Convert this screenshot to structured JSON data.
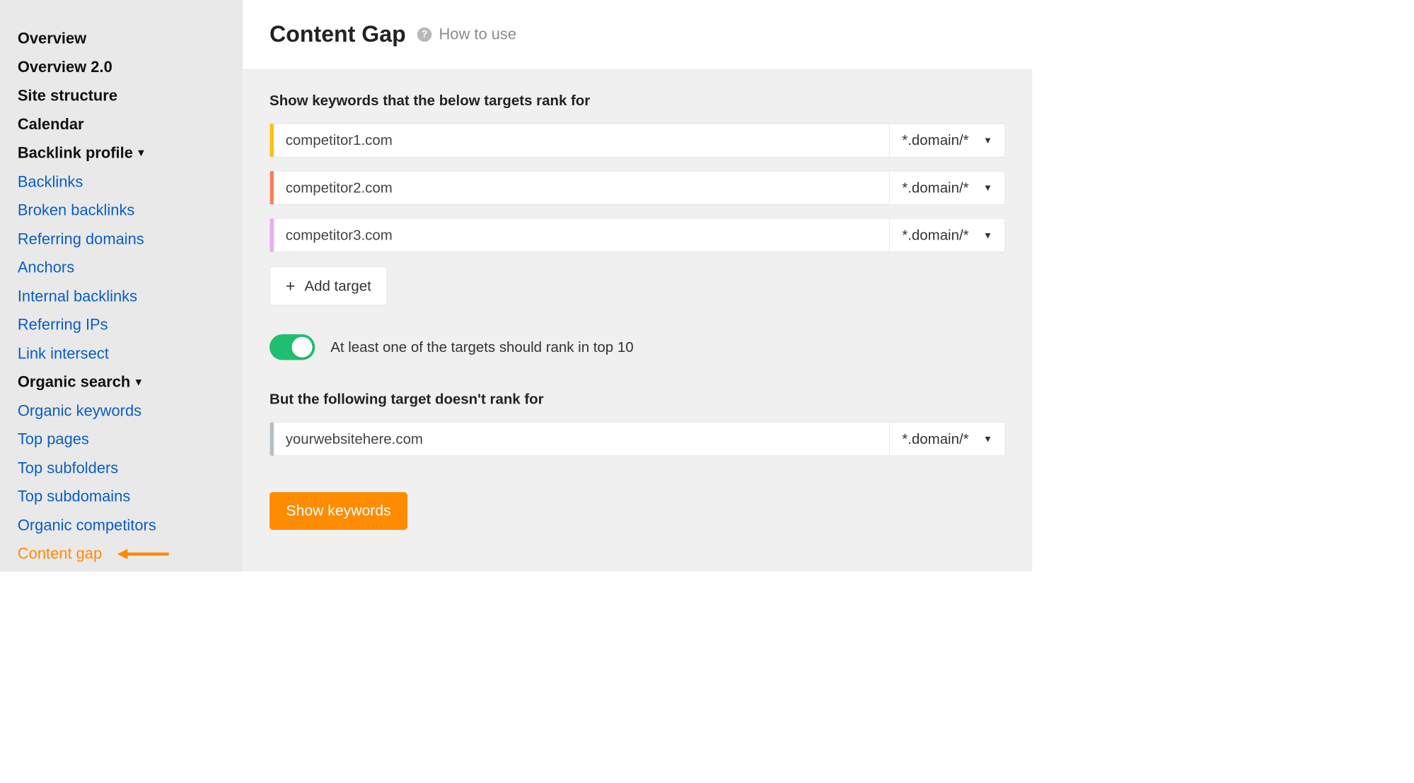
{
  "sidebar": {
    "items": [
      {
        "label": "Overview",
        "type": "section-head",
        "caret": false
      },
      {
        "label": "Overview 2.0",
        "type": "section-head",
        "caret": false
      },
      {
        "label": "Site structure",
        "type": "section-head",
        "caret": false
      },
      {
        "label": "Calendar",
        "type": "section-head",
        "caret": false
      },
      {
        "label": "Backlink profile",
        "type": "section-head",
        "caret": true
      },
      {
        "label": "Backlinks",
        "type": "link"
      },
      {
        "label": "Broken backlinks",
        "type": "link"
      },
      {
        "label": "Referring domains",
        "type": "link"
      },
      {
        "label": "Anchors",
        "type": "link"
      },
      {
        "label": "Internal backlinks",
        "type": "link"
      },
      {
        "label": "Referring IPs",
        "type": "link"
      },
      {
        "label": "Link intersect",
        "type": "link"
      },
      {
        "label": "Organic search",
        "type": "section-head",
        "caret": true
      },
      {
        "label": "Organic keywords",
        "type": "link"
      },
      {
        "label": "Top pages",
        "type": "link"
      },
      {
        "label": "Top subfolders",
        "type": "link"
      },
      {
        "label": "Top subdomains",
        "type": "link"
      },
      {
        "label": "Organic competitors",
        "type": "link"
      },
      {
        "label": "Content gap",
        "type": "link",
        "active": true
      }
    ]
  },
  "page": {
    "title": "Content Gap",
    "help": "How to use"
  },
  "form": {
    "targets_heading": "Show keywords that the below targets rank for",
    "mode_label": "*.domain/*",
    "targets": [
      {
        "value": "competitor1.com",
        "color": "yellow"
      },
      {
        "value": "competitor2.com",
        "color": "orange"
      },
      {
        "value": "competitor3.com",
        "color": "pink"
      }
    ],
    "add_target_label": "Add target",
    "toggle_label": "At least one of the targets should rank in top 10",
    "toggle_on": true,
    "exclude_heading": "But the following target doesn't rank for",
    "exclude": {
      "value": "yourwebsitehere.com",
      "color": "grey"
    },
    "submit_label": "Show keywords"
  },
  "colors": {
    "accent": "#ff8b00",
    "link": "#0a5dc2",
    "toggle_on": "#1fbf72"
  }
}
